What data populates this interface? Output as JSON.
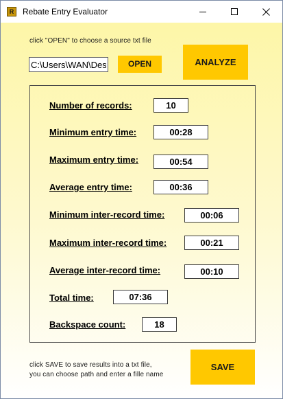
{
  "window": {
    "title": "Rebate Entry Evaluator",
    "icon_letter": "R"
  },
  "source": {
    "hint": "click \"OPEN\" to choose a source txt file",
    "path_value": "C:\\Users\\WAN\\Desktop",
    "open_label": "OPEN",
    "analyze_label": "ANALYZE"
  },
  "stats": {
    "records": {
      "label": "Number of records:",
      "value": "10"
    },
    "min_entry": {
      "label": "Minimum entry time:",
      "value": "00:28"
    },
    "max_entry": {
      "label": "Maximum entry time:",
      "value": "00:54"
    },
    "avg_entry": {
      "label": "Average entry time:",
      "value": "00:36"
    },
    "min_inter": {
      "label": "Minimum inter-record time:",
      "value": "00:06"
    },
    "max_inter": {
      "label": "Maximum inter-record time:",
      "value": "00:21"
    },
    "avg_inter": {
      "label": "Average inter-record time:",
      "value": "00:10"
    },
    "total": {
      "label": "Total time:",
      "value": "07:36"
    },
    "backspace": {
      "label": "Backspace count:",
      "value": "18"
    }
  },
  "save": {
    "hint_line1": "click SAVE to save results into a txt file,",
    "hint_line2": "you can choose path and enter a fille name",
    "save_label": "SAVE"
  },
  "colors": {
    "accent": "#ffc800",
    "background_top": "#fdf6a3"
  },
  "icons": {
    "app": "app-icon",
    "minimize": "minimize-icon",
    "maximize": "maximize-icon",
    "close": "close-icon"
  }
}
